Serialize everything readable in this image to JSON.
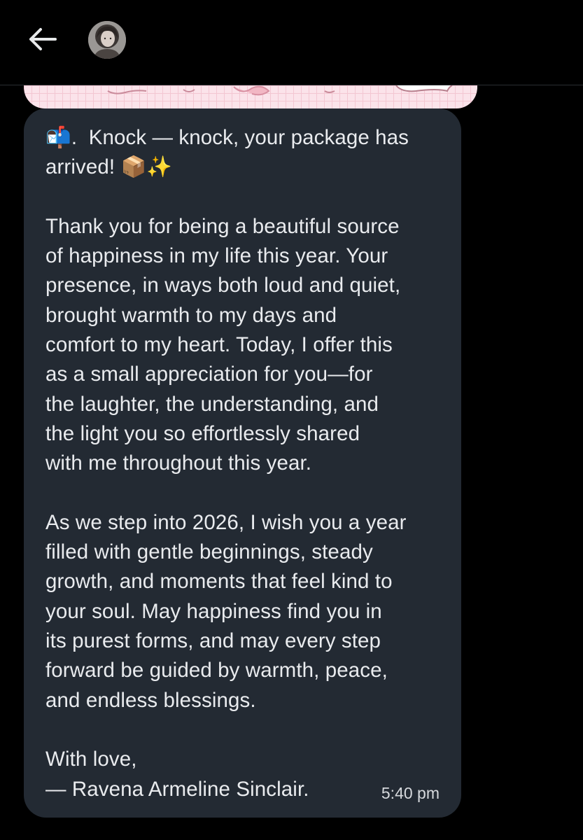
{
  "header": {
    "back_icon": "arrow-left-icon",
    "avatar_icon": "profile-avatar"
  },
  "message": {
    "text": "📬.  Knock — knock, your package has\narrived! 📦✨\n\nThank you for being a beautiful source\nof happiness in my life this year. Your\npresence, in ways both loud and quiet,\nbrought warmth to my days and\ncomfort to my heart. Today, I offer this\nas a small appreciation for you—for\nthe laughter, the understanding, and\nthe light you so effortlessly shared\nwith me throughout this year.\n\nAs we step into 2026, I wish you a year\nfilled with gentle beginnings, steady\ngrowth, and moments that feel kind to\nyour soul. May happiness find you in\nits purest forms, and may every step\nforward be guided by warmth, peace,\nand endless blessings.\n\nWith love,\n— Ravena Armeline Sinclair.",
    "timestamp": "5:40 pm"
  },
  "colors": {
    "background": "#000000",
    "bubble": "#232a33",
    "text": "#e9ebee",
    "image_tint": "#fbe3ea"
  }
}
